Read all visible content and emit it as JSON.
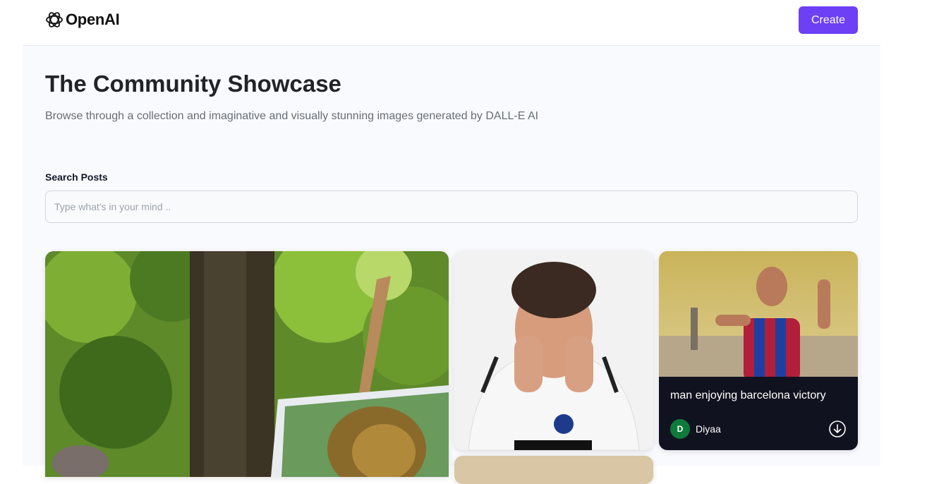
{
  "header": {
    "logo_text": "OpenAI",
    "create_label": "Create"
  },
  "hero": {
    "title": "The Community Showcase",
    "subtitle": "Browse through a collection and imaginative and visually stunning images generated by DALL-E AI"
  },
  "search": {
    "label": "Search Posts",
    "placeholder": "Type what's in your mind ..",
    "value": ""
  },
  "posts": [
    {
      "image": "painting-lion-in-forest",
      "prompt": "",
      "author": ""
    },
    {
      "image": "man-stressed-in-football-shirt",
      "prompt": "",
      "author": ""
    },
    {
      "image": "man-celebrating-in-barcelona-shirt",
      "prompt": "man enjoying barcelona victory",
      "author": "Diyaa",
      "avatar_letter": "D"
    },
    {
      "image": "sand-colored-image",
      "prompt": "",
      "author": ""
    }
  ],
  "colors": {
    "accent": "#6d3ff5",
    "avatar": "#0e7a3a",
    "overlay": "#10131f"
  }
}
